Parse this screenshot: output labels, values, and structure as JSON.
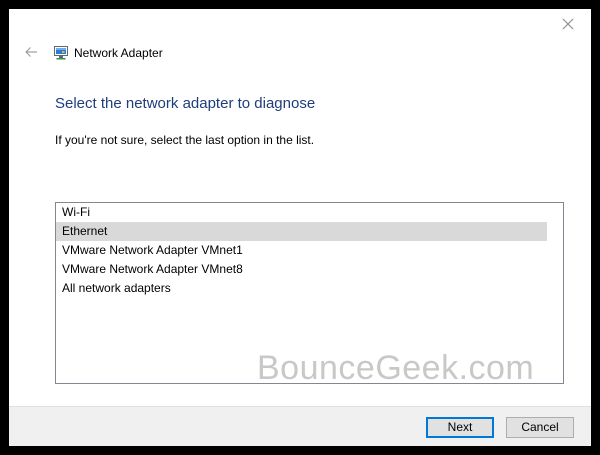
{
  "window": {
    "app_title": "Network Adapter",
    "app_icon": "network-adapter-icon",
    "close_icon": "close-icon",
    "back_icon": "back-arrow-icon"
  },
  "content": {
    "heading": "Select the network adapter to diagnose",
    "hint": "If you're not sure, select the last option in the list.",
    "adapters": [
      {
        "label": "Wi-Fi",
        "selected": false
      },
      {
        "label": "Ethernet",
        "selected": true
      },
      {
        "label": "VMware Network Adapter VMnet1",
        "selected": false
      },
      {
        "label": "VMware Network Adapter VMnet8",
        "selected": false
      },
      {
        "label": "All network adapters",
        "selected": false
      }
    ],
    "watermark": "BounceGeek.com"
  },
  "footer": {
    "next_label": "Next",
    "cancel_label": "Cancel"
  },
  "colors": {
    "heading": "#1e3d7b",
    "selection": "#d9d9d9",
    "primary_border": "#0078d7",
    "footer_bg": "#f0f0f0"
  }
}
